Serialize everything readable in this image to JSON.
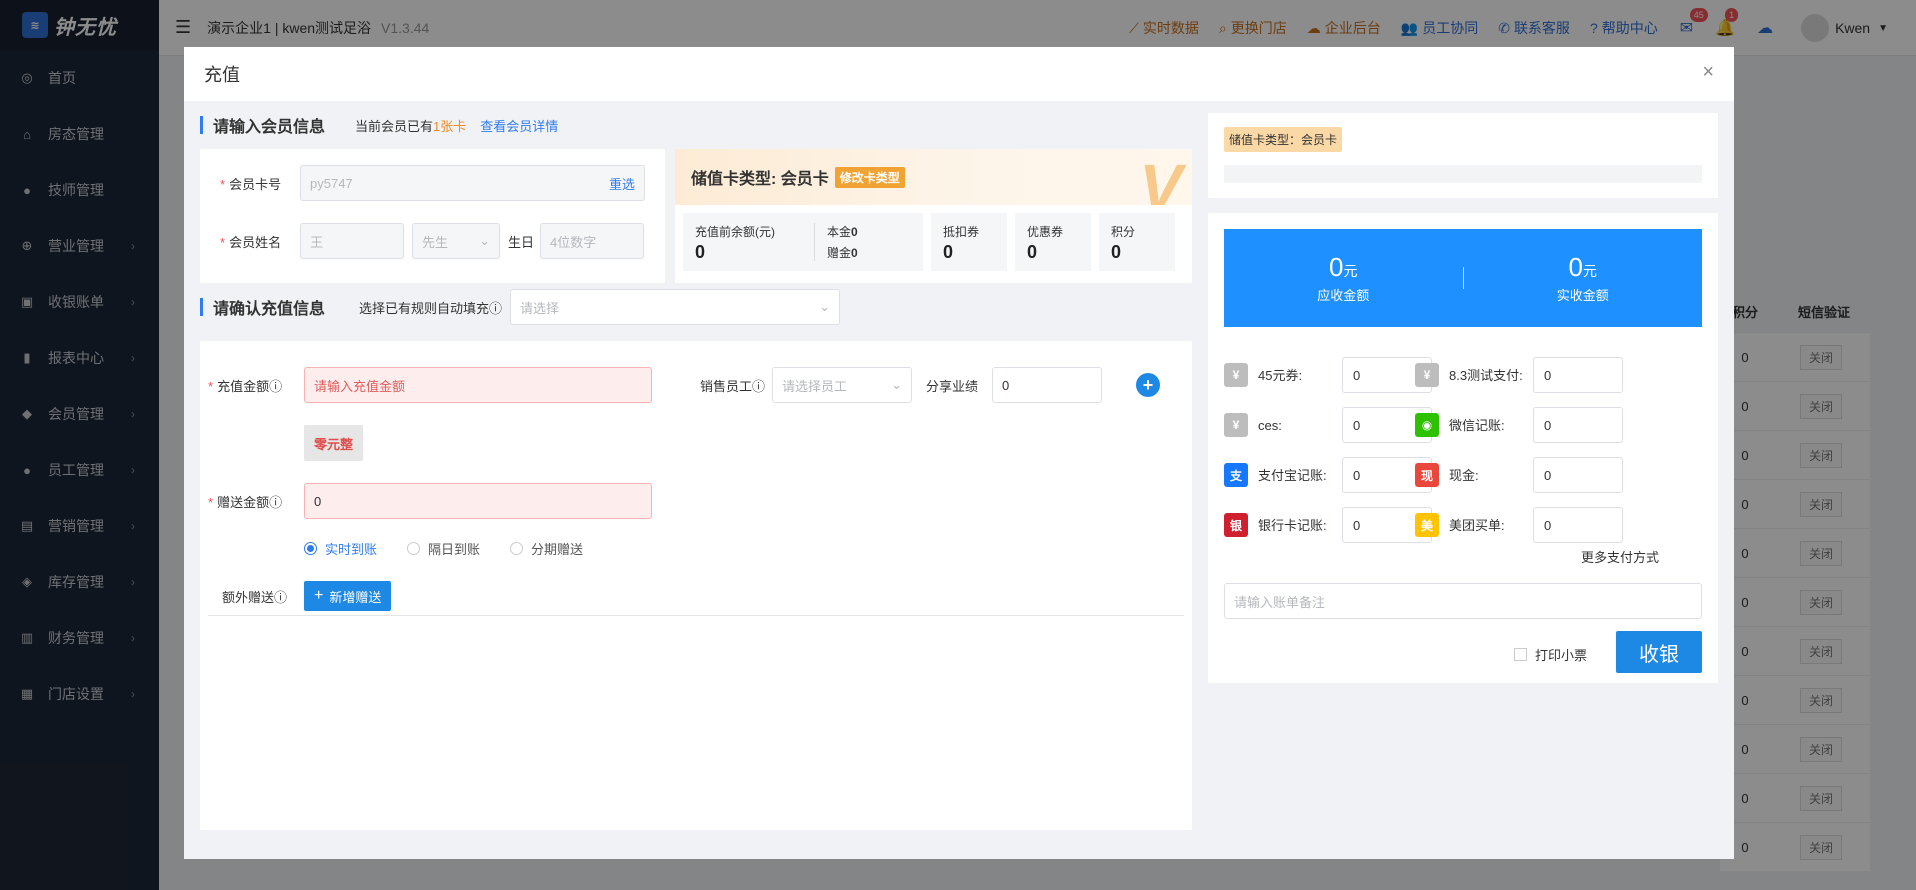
{
  "app": {
    "logo_badge": "钟无忧",
    "logo_text": "钟无忧",
    "company": "演示企业1 | kwen测试足浴",
    "version": "V1.3.44"
  },
  "sidebar": {
    "items": [
      {
        "label": "首页",
        "icon": "dashboard-icon",
        "chev": false
      },
      {
        "label": "房态管理",
        "icon": "home-icon",
        "chev": false
      },
      {
        "label": "技师管理",
        "icon": "person-icon",
        "chev": false
      },
      {
        "label": "营业管理",
        "icon": "target-icon",
        "chev": true
      },
      {
        "label": "收银账单",
        "icon": "bag-icon",
        "chev": true
      },
      {
        "label": "报表中心",
        "icon": "bar-chart-icon",
        "chev": true
      },
      {
        "label": "会员管理",
        "icon": "diamond-icon",
        "chev": true
      },
      {
        "label": "员工管理",
        "icon": "person-icon",
        "chev": true
      },
      {
        "label": "营销管理",
        "icon": "briefcase-icon",
        "chev": true
      },
      {
        "label": "库存管理",
        "icon": "box-icon",
        "chev": true
      },
      {
        "label": "财务管理",
        "icon": "wallet-icon",
        "chev": true
      },
      {
        "label": "门店设置",
        "icon": "grid-icon",
        "chev": true
      }
    ]
  },
  "header": {
    "links": [
      {
        "label": "实时数据",
        "icon": "trend-icon"
      },
      {
        "label": "更换门店",
        "icon": "search-icon"
      },
      {
        "label": "企业后台",
        "icon": "cloud-icon"
      }
    ],
    "links_blue": [
      {
        "label": "员工协同",
        "icon": "people-icon"
      },
      {
        "label": "联系客服",
        "icon": "phone-icon"
      },
      {
        "label": "帮助中心",
        "icon": "help-icon"
      }
    ],
    "mail_badge": "45",
    "bell_badge": "1",
    "user_name": "Kwen"
  },
  "bg_table": {
    "headers": [
      "积分",
      "短信验证"
    ],
    "rows": [
      {
        "value": "0",
        "button": "关闭"
      },
      {
        "value": "0",
        "button": "关闭"
      },
      {
        "value": "0",
        "button": "关闭"
      },
      {
        "value": "0",
        "button": "关闭"
      },
      {
        "value": "0",
        "button": "关闭"
      },
      {
        "value": "0",
        "button": "关闭"
      },
      {
        "value": "0",
        "button": "关闭"
      },
      {
        "value": "0",
        "button": "关闭"
      },
      {
        "value": "0",
        "button": "关闭"
      },
      {
        "value": "0",
        "button": "关闭"
      },
      {
        "value": "0",
        "button": "关闭"
      }
    ]
  },
  "modal": {
    "title": "充值",
    "close_icon": "×",
    "member_section": {
      "title": "请输入会员信息",
      "sub_prefix": "当前会员已有",
      "sub_count": "1张卡",
      "detail_link": "查看会员详情",
      "card_no_label": "会员卡号",
      "card_no_value": "py5747",
      "reselect": "重选",
      "name_label": "会员姓名",
      "name_value": "王",
      "gender_value": "先生",
      "birthday_label": "生日",
      "birthday_placeholder": "4位数字"
    },
    "card_type": {
      "title": "储值卡类型: 会员卡",
      "modify": "修改卡类型",
      "mark": "V",
      "stats": [
        {
          "label": "充值前余额(元)",
          "value": "0"
        },
        {
          "label": "抵扣券",
          "value": "0"
        },
        {
          "label": "优惠券",
          "value": "0"
        },
        {
          "label": "积分",
          "value": "0"
        }
      ],
      "principal_label": "本金",
      "principal_value": "0",
      "gift_label": "赠金",
      "gift_value": "0"
    },
    "recharge_section": {
      "title": "请确认充值信息",
      "rule_label": "选择已有规则自动填充",
      "rule_placeholder": "请选择",
      "amount_label": "充值金额",
      "amount_placeholder": "请输入充值金额",
      "zero_button": "零元整",
      "staff_label": "销售员工",
      "staff_placeholder": "请选择员工",
      "share_label": "分享业绩",
      "share_value": "0",
      "gift_label": "赠送金额",
      "gift_value": "0",
      "radios": [
        "实时到账",
        "隔日到账",
        "分期赠送"
      ],
      "extra_label": "额外赠送",
      "add_gift": "新增赠送"
    },
    "right": {
      "card_tag": "储值卡类型：会员卡",
      "receivable_amount": "0",
      "receivable_unit": "元",
      "receivable_label": "应收金额",
      "received_amount": "0",
      "received_unit": "元",
      "received_label": "实收金额",
      "payments": [
        {
          "label": "45元券:",
          "value": "0",
          "icon": "yen-icon",
          "glyph": "¥",
          "color": "#bdbdbd"
        },
        {
          "label": "8.3测试支付:",
          "value": "0",
          "icon": "yen-icon",
          "glyph": "¥",
          "color": "#bdbdbd"
        },
        {
          "label": "ces:",
          "value": "0",
          "icon": "yen-icon",
          "glyph": "¥",
          "color": "#bdbdbd"
        },
        {
          "label": "微信记账:",
          "value": "0",
          "icon": "wechat-icon",
          "glyph": "◉",
          "color": "#2dc100"
        },
        {
          "label": "支付宝记账:",
          "value": "0",
          "icon": "alipay-icon",
          "glyph": "支",
          "color": "#1677ff"
        },
        {
          "label": "现金:",
          "value": "0",
          "icon": "cash-icon",
          "glyph": "现",
          "color": "#e9473c"
        },
        {
          "label": "银行卡记账:",
          "value": "0",
          "icon": "unionpay-icon",
          "glyph": "银",
          "color": "#d0202f"
        },
        {
          "label": "美团买单:",
          "value": "0",
          "icon": "meituan-icon",
          "glyph": "美",
          "color": "#ffc300"
        }
      ],
      "more_pay": "更多支付方式",
      "remark_placeholder": "请输入账单备注",
      "print_label": "打印小票",
      "cashier": "收银"
    }
  }
}
